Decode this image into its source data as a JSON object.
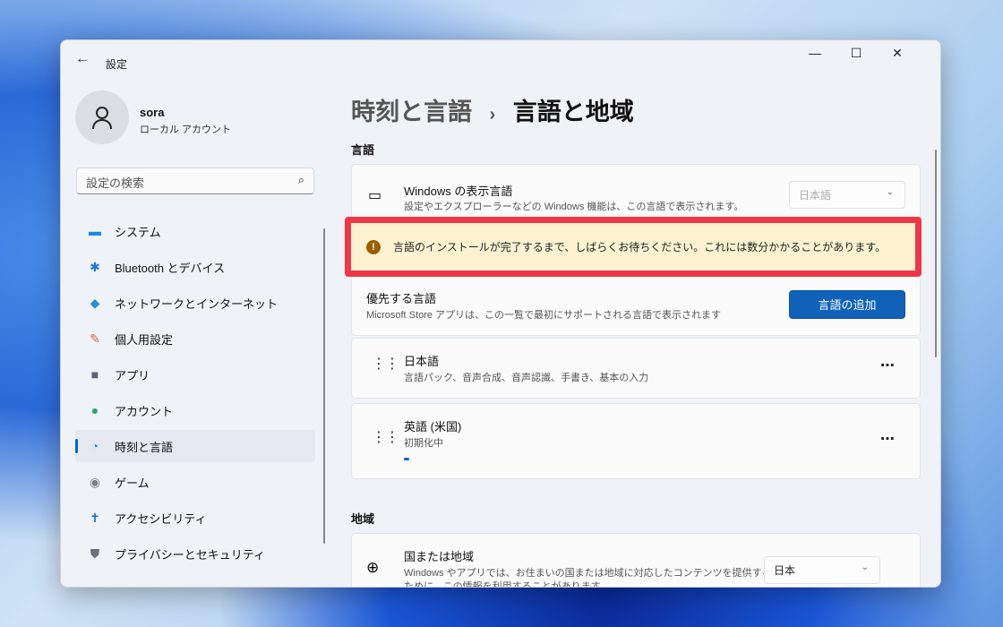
{
  "window": {
    "title": "設定",
    "back": "←",
    "minimize": "—",
    "maximize": "☐",
    "close": "✕"
  },
  "user": {
    "name": "sora",
    "account": "ローカル アカウント"
  },
  "search": {
    "placeholder": "設定の検索",
    "icon": "⌕"
  },
  "sidebar": {
    "items": [
      {
        "label": "システム",
        "icon": "▬",
        "color": "#1d8bd6"
      },
      {
        "label": "Bluetooth とデバイス",
        "icon": "✱",
        "color": "#1d78d6"
      },
      {
        "label": "ネットワークとインターネット",
        "icon": "◆",
        "color": "#2a8fd8"
      },
      {
        "label": "個人用設定",
        "icon": "✎",
        "color": "#d0663a"
      },
      {
        "label": "アプリ",
        "icon": "■",
        "color": "#5a6470"
      },
      {
        "label": "アカウント",
        "icon": "●",
        "color": "#2ba36a"
      },
      {
        "label": "時刻と言語",
        "icon": "◔",
        "color": "#2a8fd8"
      },
      {
        "label": "ゲーム",
        "icon": "◉",
        "color": "#7a8088"
      },
      {
        "label": "アクセシビリティ",
        "icon": "✝",
        "color": "#1b6fc8"
      },
      {
        "label": "プライバシーとセキュリティ",
        "icon": "⛊",
        "color": "#6b7079"
      }
    ]
  },
  "breadcrumb": {
    "parent": "時刻と言語",
    "sep": "›",
    "current": "言語と地域"
  },
  "language": {
    "heading": "言語",
    "display": {
      "title": "Windows の表示言語",
      "desc": "設定やエクスプローラーなどの Windows 機能は、この言語で表示されます。",
      "value": "日本語"
    },
    "banner": "言語のインストールが完了するまで、しばらくお待ちください。これには数分かかることがあります。",
    "preferred": {
      "title": "優先する言語",
      "desc": "Microsoft Store アプリは、この一覧で最初にサポートされる言語で表示されます",
      "button": "言語の追加"
    },
    "list": [
      {
        "name": "日本語",
        "desc": "言語パック、音声合成、音声認識、手書き、基本の入力"
      },
      {
        "name": "英語 (米国)",
        "desc": "初期化中",
        "progress": 0.02
      }
    ]
  },
  "region": {
    "heading": "地域",
    "country": {
      "title": "国または地域",
      "desc1": "Windows やアプリでは、お住まいの国または地域に対応したコンテンツを提供する",
      "desc2": "ために、この情報を利用することがあります",
      "value": "日本"
    }
  }
}
